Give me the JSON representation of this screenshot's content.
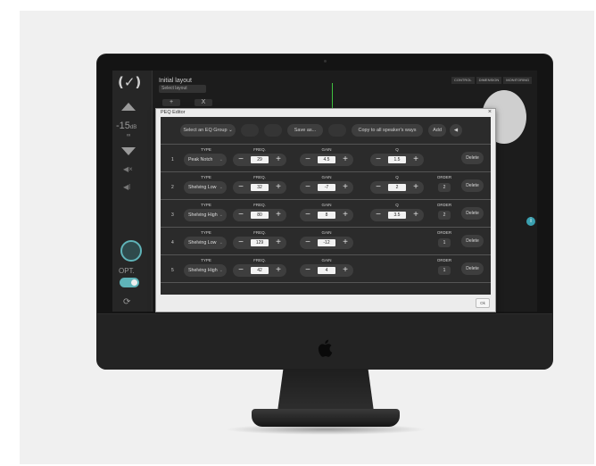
{
  "background_app": {
    "volume_value": "-15",
    "volume_unit": "∞",
    "layout_title": "Initial layout",
    "layout_select": "Select layout",
    "add_label": "+",
    "remove_label": "X",
    "opt_label": "OPT.",
    "tabs": [
      "CONTROL",
      "DIMENSION",
      "MONITORING"
    ],
    "info_label": "i"
  },
  "dialog": {
    "title": "PEQ Editor",
    "close_label": "×",
    "ok_label": "Ok",
    "toolbar": {
      "eq_group": "Select an EQ Group",
      "save_as": "Save as...",
      "copy": "Copy to all speaker's ways",
      "add": "Add",
      "speaker_icon": "speaker-icon"
    },
    "headers": {
      "type": "TYPE",
      "freq": "FREQ.",
      "gain": "GAIN",
      "q": "Q",
      "order": "ORDER"
    },
    "minus": "−",
    "plus": "+",
    "delete_label": "Delete",
    "rows": [
      {
        "num": "1",
        "type": "Peak Notch",
        "freq": "29",
        "gain": "4.5",
        "q": "1.5",
        "order": null
      },
      {
        "num": "2",
        "type": "Shelving Low",
        "freq": "32",
        "gain": "-7",
        "q": "2",
        "order": "2"
      },
      {
        "num": "3",
        "type": "Shelving High",
        "freq": "80",
        "gain": "8",
        "q": "3.5",
        "order": "2"
      },
      {
        "num": "4",
        "type": "Shelving Low",
        "freq": "129",
        "gain": "-12",
        "q": null,
        "order": "1"
      },
      {
        "num": "5",
        "type": "Shelving High",
        "freq": "42",
        "gain": "4",
        "q": null,
        "order": "1"
      }
    ]
  },
  "colors": {
    "accent": "#5fb3b8",
    "dialog_bg": "#2b2b2b"
  }
}
